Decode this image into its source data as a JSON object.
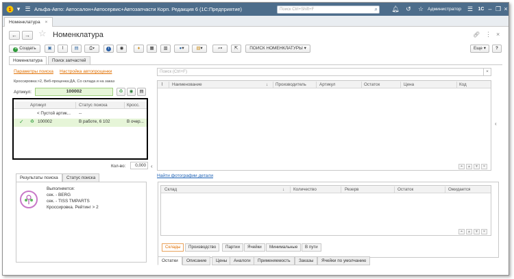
{
  "titlebar": {
    "title": "Альфа-Авто: Автосалон+Автосервис+Автозапчасти Корп. Редакция 6  (1С:Предприятие)",
    "search_placeholder": "Поиск Ctrl+Shift+F",
    "user": "Администратор",
    "logo": "1С"
  },
  "tabs": {
    "active": "Номенклатура"
  },
  "header": {
    "title": "Номенклатура"
  },
  "toolbar": {
    "create_label": "Создать",
    "search_button_label": "ПОИСК НОМЕНКЛАТУРЫ",
    "more_label": "Еще"
  },
  "main_tabs": [
    "Номенклатура",
    "Поиск запчастей"
  ],
  "left": {
    "link_params": "Параметры поиска",
    "link_settings": "Настройка автопроценки",
    "info_line": "Кроссировка:>2, Веб-проценка:ДА, Со склада и на заказ",
    "article_label": "Артикул:",
    "article_value": "100002",
    "grid": {
      "columns": [
        "Артикул",
        "Статус поиска",
        "Кросс."
      ],
      "rows": [
        {
          "article": "< Пустой артик...",
          "status": "--",
          "cross": ""
        },
        {
          "article": "100002",
          "status": "В работе, 6 102",
          "cross": "В очер..."
        }
      ]
    },
    "qty_label": "Кол-во:",
    "qty_value": "0,000",
    "bottom_tabs": [
      "Результаты поиска",
      "Статус поиска"
    ],
    "status_lines": [
      "Выполняется:",
      "сек. - BERG",
      "сек. - TISS TMPARTS",
      "Кроссировка. Рейтинг > 2"
    ]
  },
  "right": {
    "search_placeholder": "Поиск (Ctrl+F)",
    "grid_columns": [
      "Наименование",
      "Производитель",
      "Артикул",
      "Остаток",
      "Цена",
      "Код"
    ],
    "photo_link": "Найти фотографии детали",
    "stock_columns": [
      "Склад",
      "Количество",
      "Резерв",
      "Остаток",
      "Ожидается"
    ],
    "stock_tabs": [
      "Склады",
      "Производство",
      "Партии",
      "Ячейки",
      "Минимальные",
      "В пути"
    ],
    "bottom_tabs": [
      "Остатки",
      "Описание",
      "Цены",
      "Аналоги",
      "Применяемость",
      "Заказы",
      "Ячейки по умолчанию"
    ]
  },
  "colors": {
    "titlebar": "#4d6d8b",
    "accent_orange": "#e06f00",
    "create_green": "#2e9b3a",
    "highlight_green": "#e6f5d8"
  }
}
